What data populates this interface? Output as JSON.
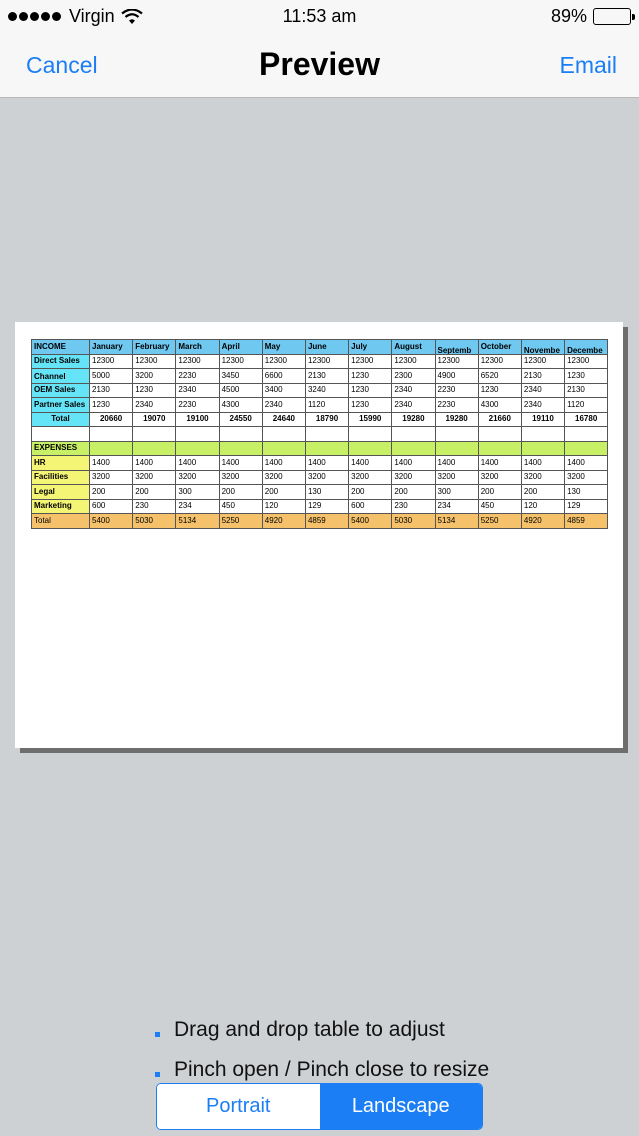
{
  "status_bar": {
    "carrier": "Virgin",
    "time": "11:53 am",
    "battery": "89%",
    "battery_level": 0.89
  },
  "nav": {
    "cancel": "Cancel",
    "title": "Preview",
    "email": "Email"
  },
  "sheet": {
    "header": [
      "INCOME",
      "January",
      "February",
      "March",
      "April",
      "May",
      "June",
      "July",
      "August",
      "Septemb",
      "October",
      "Novembe",
      "Decembe"
    ],
    "income_rows": [
      {
        "label": "Direct Sales",
        "values": [
          "12300",
          "12300",
          "12300",
          "12300",
          "12300",
          "12300",
          "12300",
          "12300",
          "12300",
          "12300",
          "12300",
          "12300"
        ]
      },
      {
        "label": "Channel",
        "values": [
          "5000",
          "3200",
          "2230",
          "3450",
          "6600",
          "2130",
          "1230",
          "2300",
          "4900",
          "6520",
          "2130",
          "1230"
        ]
      },
      {
        "label": "OEM Sales",
        "values": [
          "2130",
          "1230",
          "2340",
          "4500",
          "3400",
          "3240",
          "1230",
          "2340",
          "2230",
          "1230",
          "2340",
          "2130"
        ]
      },
      {
        "label": "Partner Sales",
        "values": [
          "1230",
          "2340",
          "2230",
          "4300",
          "2340",
          "1120",
          "1230",
          "2340",
          "2230",
          "4300",
          "2340",
          "1120"
        ]
      }
    ],
    "income_total": {
      "label": "Total",
      "values": [
        "20660",
        "19070",
        "19100",
        "24550",
        "24640",
        "18790",
        "15990",
        "19280",
        "19280",
        "21660",
        "19110",
        "16780"
      ]
    },
    "expenses_label": "EXPENSES",
    "expense_rows": [
      {
        "label": "HR",
        "values": [
          "1400",
          "1400",
          "1400",
          "1400",
          "1400",
          "1400",
          "1400",
          "1400",
          "1400",
          "1400",
          "1400",
          "1400"
        ]
      },
      {
        "label": "Facilities",
        "values": [
          "3200",
          "3200",
          "3200",
          "3200",
          "3200",
          "3200",
          "3200",
          "3200",
          "3200",
          "3200",
          "3200",
          "3200"
        ]
      },
      {
        "label": "Legal",
        "values": [
          "200",
          "200",
          "300",
          "200",
          "200",
          "130",
          "200",
          "200",
          "300",
          "200",
          "200",
          "130"
        ]
      },
      {
        "label": "Marketing",
        "values": [
          "600",
          "230",
          "234",
          "450",
          "120",
          "129",
          "600",
          "230",
          "234",
          "450",
          "120",
          "129"
        ]
      }
    ],
    "expense_total": {
      "label": "Total",
      "values": [
        "5400",
        "5030",
        "5134",
        "5250",
        "4920",
        "4859",
        "5400",
        "5030",
        "5134",
        "5250",
        "4920",
        "4859"
      ]
    }
  },
  "tips": [
    "Drag and drop table to adjust",
    "Pinch open / Pinch close to resize"
  ],
  "orientation": {
    "portrait": "Portrait",
    "landscape": "Landscape",
    "selected": "Landscape"
  },
  "colors": {
    "accent": "#1b7ef5",
    "header_blue": "#6ec8f0",
    "label_cyan": "#66e4f7",
    "label_yellow": "#f4f574",
    "expenses_green": "#c7f066",
    "total_orange": "#f5c26b"
  }
}
